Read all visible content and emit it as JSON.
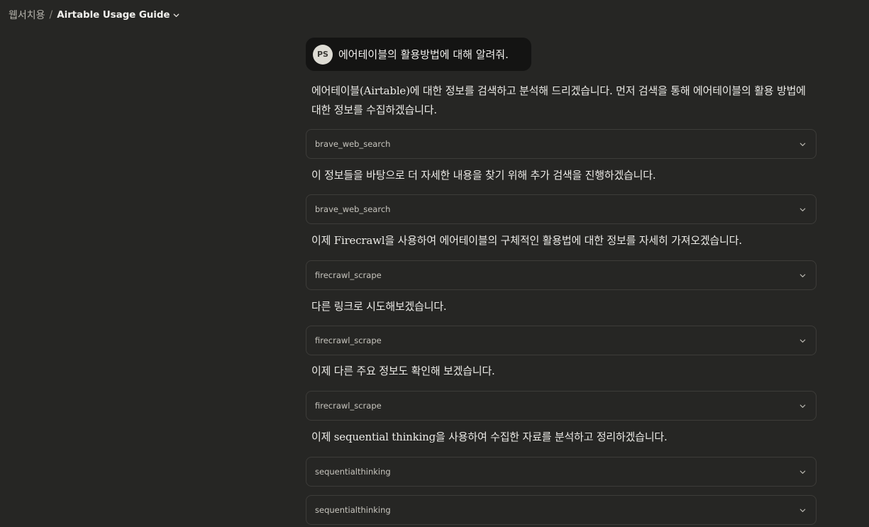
{
  "breadcrumb": {
    "project": "웹서치용",
    "separator": "/",
    "title": "Airtable Usage Guide"
  },
  "user_message": {
    "avatar_initials": "PS",
    "text": "에어테이블의 활용방법에 대해 알려줘."
  },
  "assistant": {
    "paragraphs": [
      "에어테이블(Airtable)에 대한 정보를 검색하고 분석해 드리겠습니다. 먼저 검색을 통해 에어테이블의 활용 방법에 대한 정보를 수집하겠습니다.",
      "이 정보들을 바탕으로 더 자세한 내용을 찾기 위해 추가 검색을 진행하겠습니다.",
      "이제 Firecrawl을 사용하여 에어테이블의 구체적인 활용법에 대한 정보를 자세히 가져오겠습니다.",
      "다른 링크로 시도해보겠습니다.",
      "이제 다른 주요 정보도 확인해 보겠습니다.",
      "이제 sequential thinking을 사용하여 수집한 자료를 분석하고 정리하겠습니다."
    ],
    "tools": [
      "brave_web_search",
      "brave_web_search",
      "firecrawl_scrape",
      "firecrawl_scrape",
      "firecrawl_scrape",
      "sequentialthinking",
      "sequentialthinking"
    ]
  },
  "colors": {
    "background": "#262624",
    "user_bubble": "#141413",
    "tool_border": "#3d3c39",
    "text": "#ecebe7"
  },
  "icons": {
    "title_dropdown": "chevron-down-icon",
    "tool_expand": "chevron-down-icon"
  }
}
